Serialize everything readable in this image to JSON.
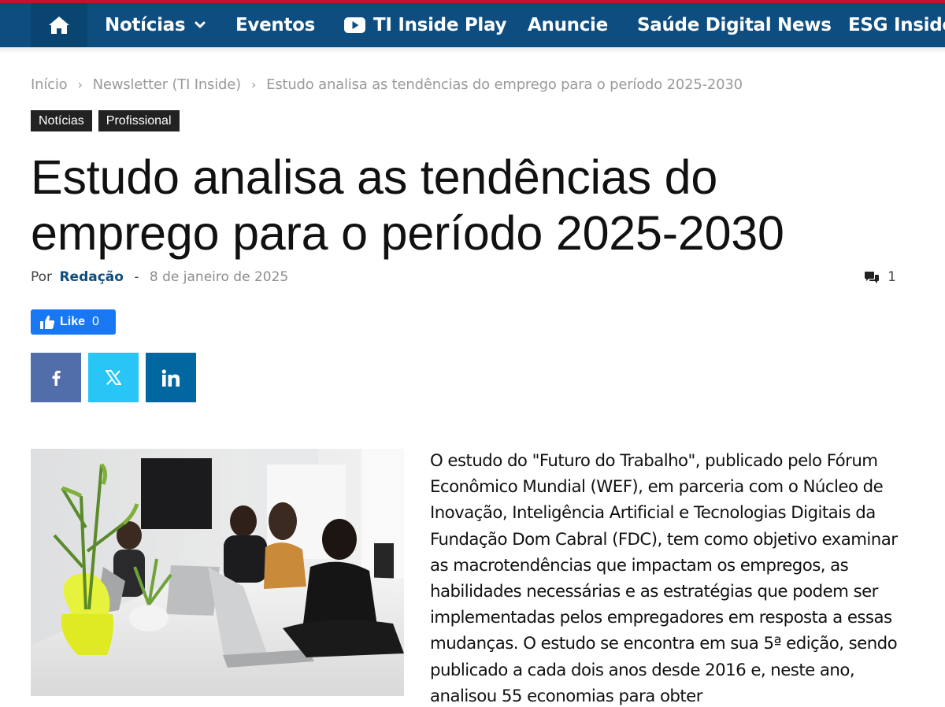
{
  "nav": {
    "home_icon": "home-icon",
    "items": [
      {
        "label": "Notícias",
        "has_dropdown": true
      },
      {
        "label": "Eventos"
      },
      {
        "label": "TI Inside Play",
        "icon": "youtube-icon"
      },
      {
        "label": "Anuncie"
      },
      {
        "label": "Saúde Digital News"
      },
      {
        "label": "ESG Inside"
      }
    ],
    "colors": {
      "bar": "#0d4d80",
      "accent": "#c8102e"
    }
  },
  "breadcrumb": {
    "items": [
      "Início",
      "Newsletter (TI Inside)",
      "Estudo analisa as tendências do emprego para o período 2025-2030"
    ],
    "separator": "›"
  },
  "tags": [
    "Notícias",
    "Profissional"
  ],
  "article": {
    "title": "Estudo analisa as tendências do emprego para o período 2025-2030",
    "by_label": "Por",
    "author": "Redação",
    "date_separator": "-",
    "date": "8 de janeiro de 2025",
    "comment_count": "1",
    "body": "O estudo do \"Futuro do Trabalho\", publicado pelo Fórum Econômico Mundial (WEF), em parceria com o Núcleo de Inovação, Inteligência Artificial e Tecnologias Digitais da Fundação Dom Cabral (FDC), tem como objetivo examinar as macrotendências que impactam os empregos, as habilidades necessárias e as estratégias que podem ser implementadas pelos empregadores em resposta a essas mudanças. O estudo se encontra em sua 5ª edição, sendo publicado a cada dois anos desde 2016 e, neste ano, analisou 55 economias para obter"
  },
  "like": {
    "label": "Like",
    "count": "0",
    "color": "#1877f2"
  },
  "share": [
    {
      "network": "facebook",
      "icon": "facebook-icon",
      "color": "#516eab"
    },
    {
      "network": "x",
      "icon": "x-icon",
      "color": "#29c5f6"
    },
    {
      "network": "linkedin",
      "icon": "linkedin-icon",
      "color": "#0266a0"
    }
  ]
}
